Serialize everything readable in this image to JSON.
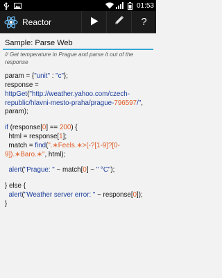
{
  "status": {
    "time": "01:53"
  },
  "app": {
    "title": "Reactor"
  },
  "toolbar": {
    "run_icon": "play-icon",
    "edit_icon": "pencil-icon",
    "help_label": "?"
  },
  "script": {
    "title": "Sample: Parse Web"
  },
  "code": {
    "comment": "// Get temperature in Prague and parse it out of the response",
    "l1_a": "param = {",
    "l1_b": "\"unit\"",
    "l1_c": " : ",
    "l1_d": "\"c\"",
    "l1_e": "};",
    "l2_a": "response = ",
    "l2_b": "httpGet",
    "l2_c": "(",
    "l2_d": "\"http://weather.yahoo.com/czech-republic/hlavni-mesto-praha/prague-",
    "l2_e": "796597",
    "l2_f": "/\"",
    "l2_g": ", param);",
    "l3_a": "if",
    "l3_b": " (response[",
    "l3_c": "0",
    "l3_d": "] == ",
    "l3_e": "200",
    "l3_f": ") {",
    "l4_a": "  html = response[",
    "l4_b": "1",
    "l4_c": "];",
    "l5_a": "  match = ",
    "l5_b": "find",
    "l5_c": "(",
    "l5_d": "\".∗Feels.∗>(-?[1-9]?[0-9]).∗Baro.∗\"",
    "l5_e": ", html);",
    "l6_a": "  ",
    "l6_b": "alert",
    "l6_c": "(",
    "l6_d": "\"Prague: \"",
    "l6_e": " ~ match[",
    "l6_f": "0",
    "l6_g": "] ~ ",
    "l6_h": "\" °C\"",
    "l6_i": ");",
    "l7_a": "} else {",
    "l8_a": "  ",
    "l8_b": "alert",
    "l8_c": "(",
    "l8_d": "\"Weather server error: \"",
    "l8_e": " ~ response[",
    "l8_f": "0",
    "l8_g": "]);",
    "l9_a": "}"
  }
}
